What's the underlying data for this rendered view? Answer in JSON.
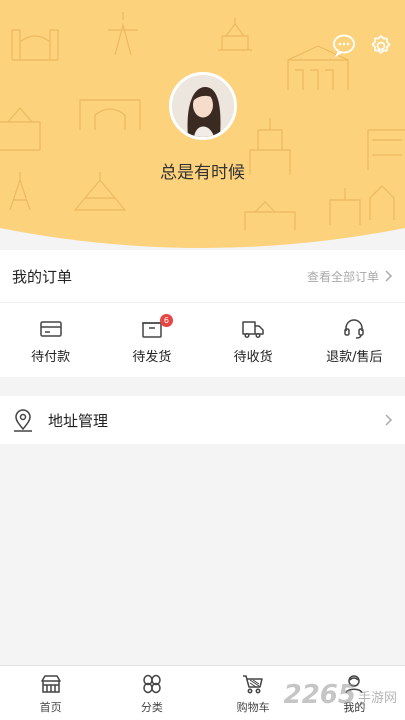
{
  "user": {
    "name": "总是有时候"
  },
  "colors": {
    "header_bg": "#fcd27c",
    "header_line": "#e9b45a",
    "badge": "#e84545"
  },
  "header": {
    "icons": [
      "chat-icon",
      "settings-icon"
    ]
  },
  "orders": {
    "title": "我的订单",
    "view_all": "查看全部订单",
    "items": [
      {
        "label": "待付款",
        "icon": "wallet-icon"
      },
      {
        "label": "待发货",
        "icon": "box-icon",
        "badge": "6"
      },
      {
        "label": "待收货",
        "icon": "truck-icon"
      },
      {
        "label": "退款/售后",
        "icon": "headset-icon"
      }
    ]
  },
  "address": {
    "label": "地址管理",
    "icon": "location-pin-icon"
  },
  "tabbar": {
    "items": [
      {
        "label": "首页",
        "icon": "home-store-icon"
      },
      {
        "label": "分类",
        "icon": "category-icon"
      },
      {
        "label": "购物车",
        "icon": "cart-icon"
      },
      {
        "label": "我的",
        "icon": "user-icon"
      }
    ]
  },
  "watermark": {
    "number": "2265",
    "text": "手游网"
  }
}
